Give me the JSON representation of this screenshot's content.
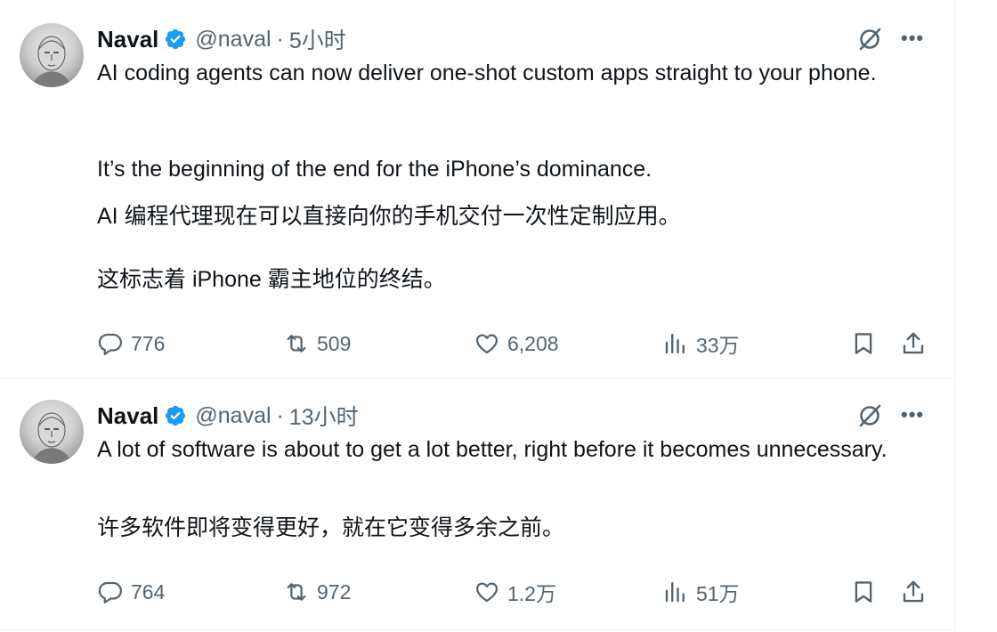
{
  "tweets": [
    {
      "author": {
        "name": "Naval",
        "handle": "@naval",
        "time": "5小时"
      },
      "paragraphs": [
        "AI coding agents can now deliver one-shot custom apps straight to your phone.",
        "It’s the beginning of the end for the iPhone’s dominance.",
        "AI 编程代理现在可以直接向你的手机交付一次性定制应用。",
        "这标志着 iPhone 霸主地位的终结。"
      ],
      "stats": {
        "replies": "776",
        "reposts": "509",
        "likes": "6,208",
        "views": "33万"
      }
    },
    {
      "author": {
        "name": "Naval",
        "handle": "@naval",
        "time": "13小时"
      },
      "paragraphs": [
        "A lot of software is about to get a lot better, right before it becomes unnecessary.",
        "许多软件即将变得更好，就在它变得多余之前。"
      ],
      "stats": {
        "replies": "764",
        "reposts": "972",
        "likes": "1.2万",
        "views": "51万"
      }
    }
  ],
  "separator": "·",
  "more_glyph": "•••",
  "icons": {
    "verified": "verified-badge-icon",
    "grok": "grok-icon",
    "more": "more-icon",
    "reply": "reply-icon",
    "repost": "repost-icon",
    "like": "heart-icon",
    "views": "views-icon",
    "bookmark": "bookmark-icon",
    "share": "share-icon"
  },
  "colors": {
    "verified": "#1d9bf0",
    "muted": "#536471",
    "text": "#0f1419",
    "divider": "#eff3f4"
  }
}
